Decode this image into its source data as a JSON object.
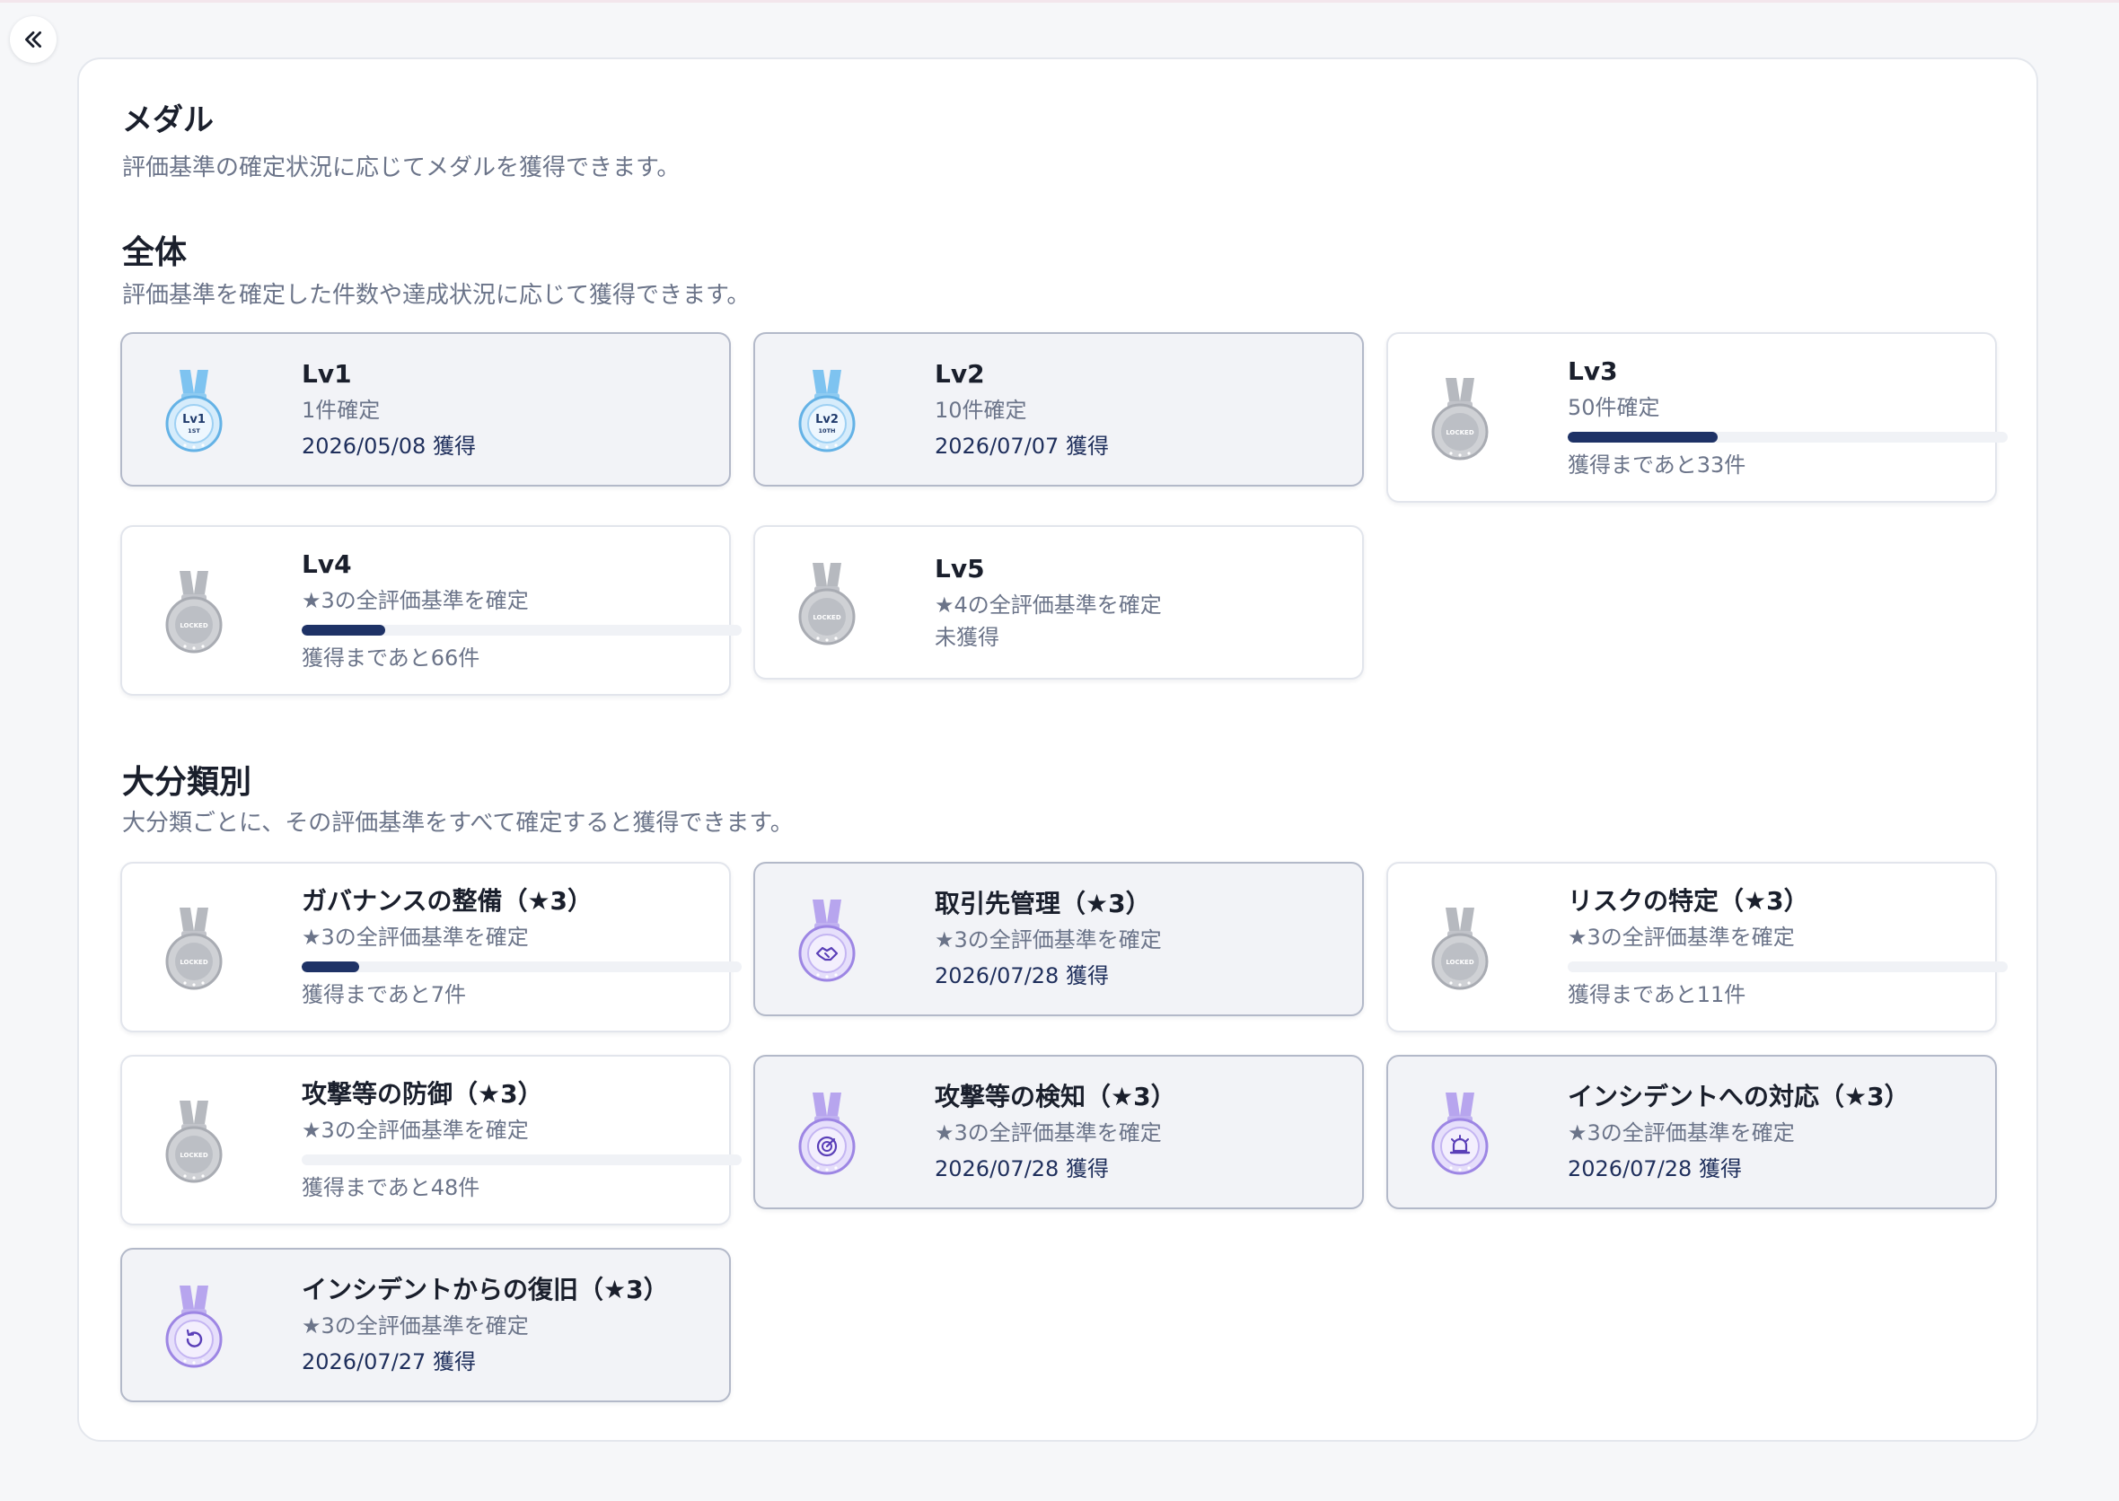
{
  "sidebar": {
    "collapse_icon": "chevrons-left-icon"
  },
  "header": {
    "title": "メダル",
    "description": "評価基準の確定状況に応じてメダルを獲得できます。"
  },
  "overall": {
    "title": "全体",
    "description": "評価基準を確定した件数や達成状況に応じて獲得できます。",
    "medals": [
      {
        "title": "Lv1",
        "subtitle": "1件確定",
        "status": "earned",
        "date": "2026/05/08 獲得",
        "badge_line1": "Lv1",
        "badge_line2": "1ST",
        "icon": "lv1-medal-icon"
      },
      {
        "title": "Lv2",
        "subtitle": "10件確定",
        "status": "earned",
        "date": "2026/07/07 獲得",
        "badge_line1": "Lv2",
        "badge_line2": "10TH",
        "icon": "lv2-medal-icon"
      },
      {
        "title": "Lv3",
        "subtitle": "50件確定",
        "status": "progress",
        "progress": 0.34,
        "remaining": "獲得まであと33件",
        "badge_text": "LOCKED",
        "icon": "locked-medal-icon"
      },
      {
        "title": "Lv4",
        "subtitle": "★3の全評価基準を確定",
        "status": "progress",
        "progress": 0.19,
        "remaining": "獲得まであと66件",
        "badge_text": "LOCKED",
        "icon": "locked-medal-icon"
      },
      {
        "title": "Lv5",
        "subtitle": "★4の全評価基準を確定",
        "status": "unearned",
        "remaining": "未獲得",
        "badge_text": "LOCKED",
        "icon": "locked-medal-icon"
      }
    ]
  },
  "categories": {
    "title": "大分類別",
    "description": "大分類ごとに、その評価基準をすべて確定すると獲得できます。",
    "medals": [
      {
        "title": "ガバナンスの整備（★3）",
        "subtitle": "★3の全評価基準を確定",
        "status": "progress",
        "progress": 0.13,
        "remaining": "獲得まであと7件",
        "badge_text": "LOCKED",
        "icon": "locked-medal-icon"
      },
      {
        "title": "取引先管理（★3）",
        "subtitle": "★3の全評価基準を確定",
        "status": "earned",
        "date": "2026/07/28 獲得",
        "icon": "handshake-medal-icon"
      },
      {
        "title": "リスクの特定（★3）",
        "subtitle": "★3の全評価基準を確定",
        "status": "progress",
        "progress": 0,
        "remaining": "獲得まであと11件",
        "badge_text": "LOCKED",
        "icon": "locked-medal-icon"
      },
      {
        "title": "攻撃等の防御（★3）",
        "subtitle": "★3の全評価基準を確定",
        "status": "progress",
        "progress": 0,
        "remaining": "獲得まであと48件",
        "badge_text": "LOCKED",
        "icon": "locked-medal-icon"
      },
      {
        "title": "攻撃等の検知（★3）",
        "subtitle": "★3の全評価基準を確定",
        "status": "earned",
        "date": "2026/07/28 獲得",
        "icon": "radar-medal-icon"
      },
      {
        "title": "インシデントへの対応（★3）",
        "subtitle": "★3の全評価基準を確定",
        "status": "earned",
        "date": "2026/07/28 獲得",
        "icon": "alarm-medal-icon"
      },
      {
        "title": "インシデントからの復旧（★3）",
        "subtitle": "★3の全評価基準を確定",
        "status": "earned",
        "date": "2026/07/27 獲得",
        "icon": "restore-medal-icon"
      }
    ]
  },
  "colors": {
    "earned_card_bg": "#f2f3f7",
    "progress_fill": "#1e3266",
    "date_text": "#1f2f5c",
    "muted_text": "#6b7489",
    "blue_medal": "#7cc4f2",
    "purple_medal": "#b8a4ee",
    "locked_medal": "#c6c8cc"
  }
}
